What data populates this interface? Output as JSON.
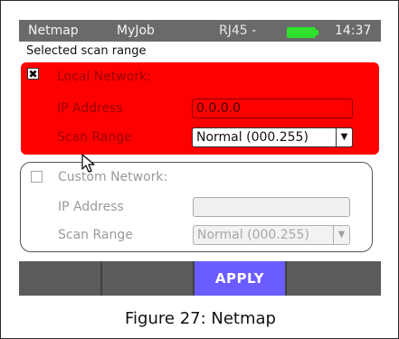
{
  "status_bar": {
    "app": "Netmap",
    "job": "MyJob",
    "port": "RJ45 -",
    "time": "14:37",
    "battery_color": "#2fe02f",
    "background": "#6a6a6a"
  },
  "heading": "Selected scan range",
  "local_network": {
    "checked": true,
    "check_mark": "✖",
    "label": "Local Network:",
    "ip_label": "IP Address",
    "ip_value": "0.0.0.0",
    "range_label": "Scan Range",
    "range_value": "Normal (000.255)",
    "color": "#ff0000"
  },
  "custom_network": {
    "checked": false,
    "label": "Custom Network:",
    "ip_label": "IP Address",
    "ip_value": "",
    "range_label": "Scan Range",
    "range_value": "Normal (000.255)"
  },
  "dropdown_arrow": "▼",
  "softkeys": [
    {
      "label": ""
    },
    {
      "label": ""
    },
    {
      "label": "APPLY",
      "color": "#6b5cff"
    },
    {
      "label": ""
    }
  ],
  "caption": "Figure 27: Netmap",
  "icons": {
    "battery": "battery-icon",
    "cursor": "mouse-cursor-icon"
  }
}
